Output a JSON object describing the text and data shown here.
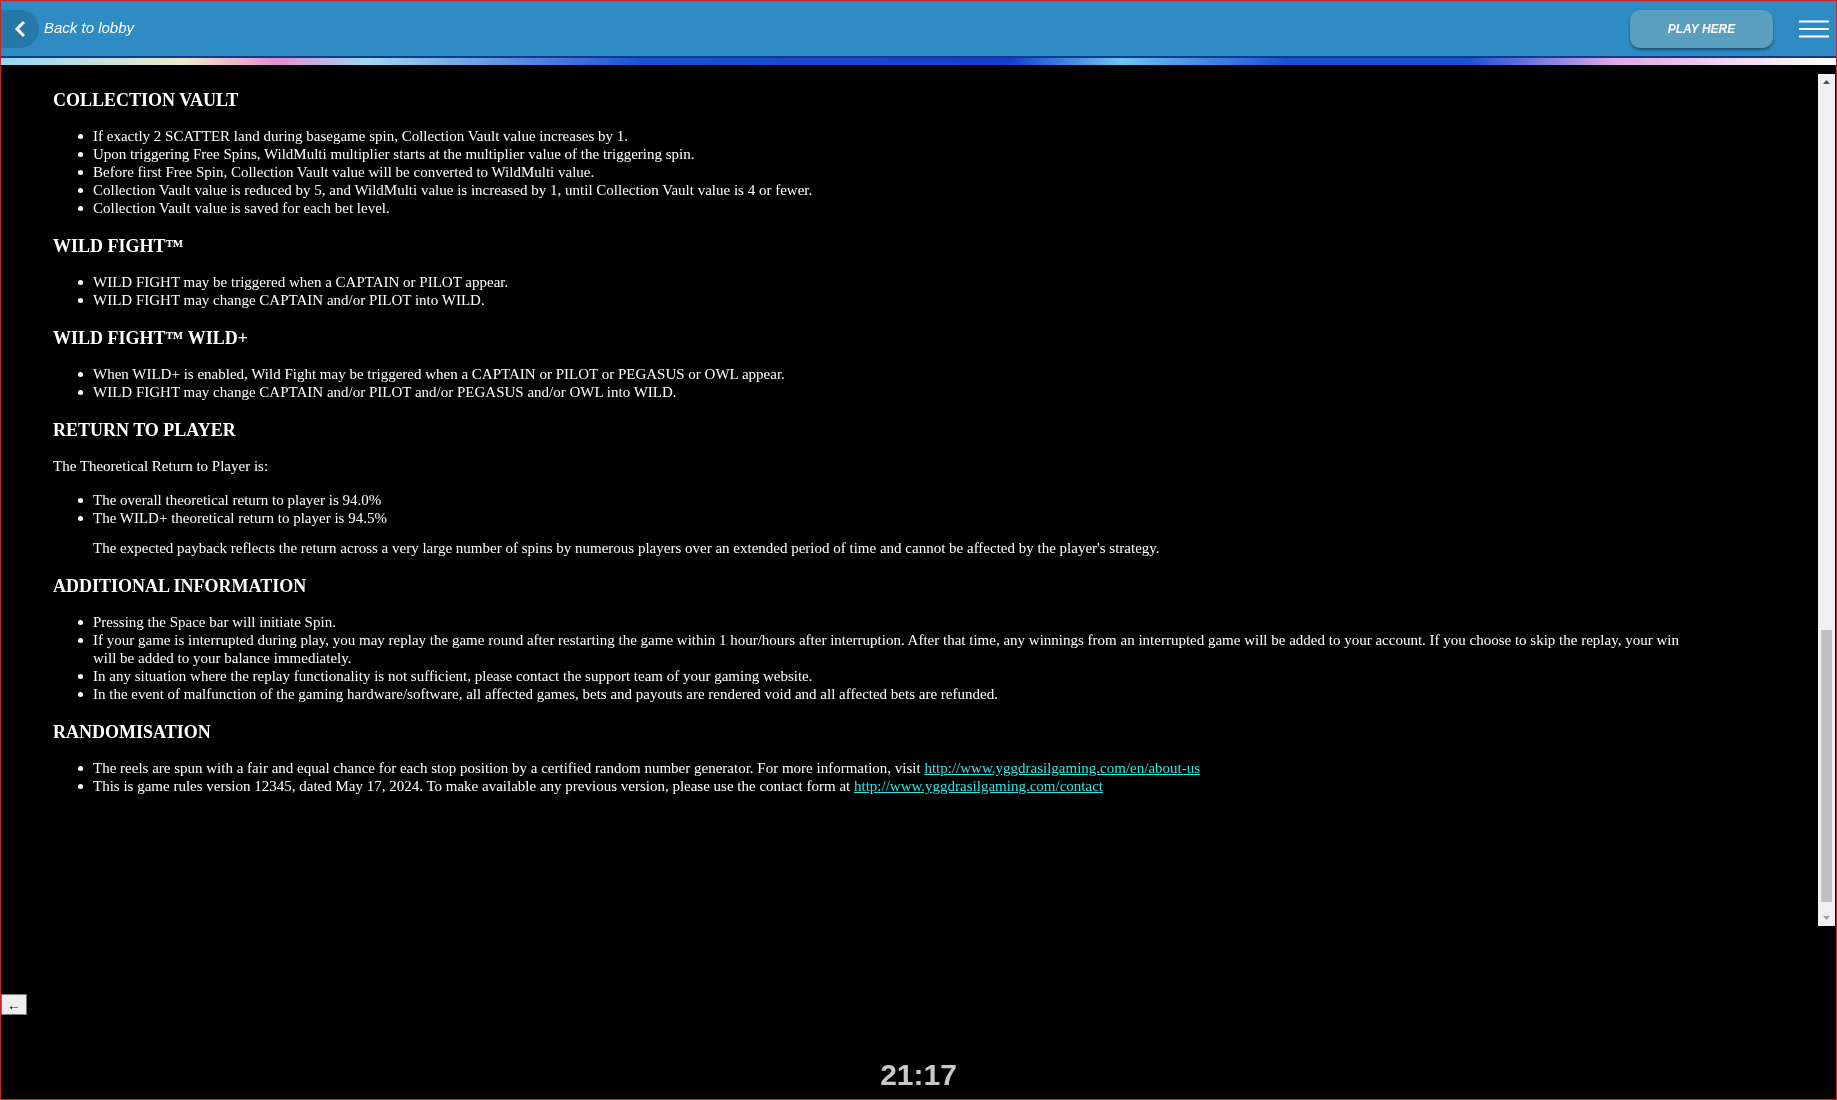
{
  "header": {
    "back_label": "Back to lobby",
    "play_button": "PLAY HERE"
  },
  "sections": [
    {
      "title": "COLLECTION VAULT",
      "blocks": [
        {
          "kind": "list",
          "items": [
            {
              "text": "If exactly 2 SCATTER land during basegame spin, Collection Vault value increases by 1."
            },
            {
              "text": "Upon triggering Free Spins, WildMulti multiplier starts at the multiplier value of the triggering spin."
            },
            {
              "text": "Before first Free Spin, Collection Vault value will be converted to WildMulti value."
            },
            {
              "text": "Collection Vault value is reduced by 5, and WildMulti value is increased by 1, until Collection Vault value is 4 or fewer."
            },
            {
              "text": "Collection Vault value is saved for each bet level."
            }
          ]
        }
      ]
    },
    {
      "title": "WILD FIGHT™",
      "blocks": [
        {
          "kind": "list",
          "items": [
            {
              "text": "WILD FIGHT may be triggered when a CAPTAIN or PILOT appear."
            },
            {
              "text": "WILD FIGHT may change CAPTAIN and/or PILOT into WILD."
            }
          ]
        }
      ]
    },
    {
      "title": "WILD FIGHT™ WILD+",
      "blocks": [
        {
          "kind": "list",
          "items": [
            {
              "text": "When WILD+ is enabled, Wild Fight may be triggered when a CAPTAIN or PILOT or PEGASUS or OWL appear."
            },
            {
              "text": "WILD FIGHT may change CAPTAIN and/or PILOT and/or PEGASUS and/or OWL into WILD."
            }
          ]
        }
      ]
    },
    {
      "title": "RETURN TO PLAYER",
      "blocks": [
        {
          "kind": "paragraph",
          "text": "The Theoretical Return to Player is:"
        },
        {
          "kind": "list",
          "items": [
            {
              "text": "The overall theoretical return to player is 94.0%"
            },
            {
              "text": "The WILD+ theoretical return to player is 94.5%"
            }
          ]
        },
        {
          "kind": "note",
          "text": "The expected payback reflects the return across a very large number of spins by numerous players over an extended period of time and cannot be affected by the player's strategy."
        }
      ]
    },
    {
      "title": "ADDITIONAL INFORMATION",
      "blocks": [
        {
          "kind": "list",
          "items": [
            {
              "text": "Pressing the Space bar will initiate Spin."
            },
            {
              "text": "If your game is interrupted during play, you may replay the game round after restarting the game within 1 hour/hours after interruption. After that time, any winnings from an interrupted game will be added to your account. If you choose to skip the replay, your win will be added to your balance immediately."
            },
            {
              "text": "In any situation where the replay functionality is not sufficient, please contact the support team of your gaming website."
            },
            {
              "text": "In the event of malfunction of the gaming hardware/software, all affected games, bets and payouts are rendered void and all affected bets are refunded."
            }
          ]
        }
      ]
    },
    {
      "title": "RANDOMISATION",
      "blocks": [
        {
          "kind": "list",
          "items": [
            {
              "text": "The reels are spun with a fair and equal chance for each stop position by a certified random number generator. For more information, visit",
              "link": "http://www.yggdrasilgaming.com/en/about-us"
            },
            {
              "text": "This is game rules version 12345, dated May 17, 2024. To make available any previous version, please use the contact form at",
              "link": "http://www.yggdrasilgaming.com/contact"
            }
          ]
        }
      ]
    }
  ],
  "back_arrow": "←",
  "clock": "21:17"
}
